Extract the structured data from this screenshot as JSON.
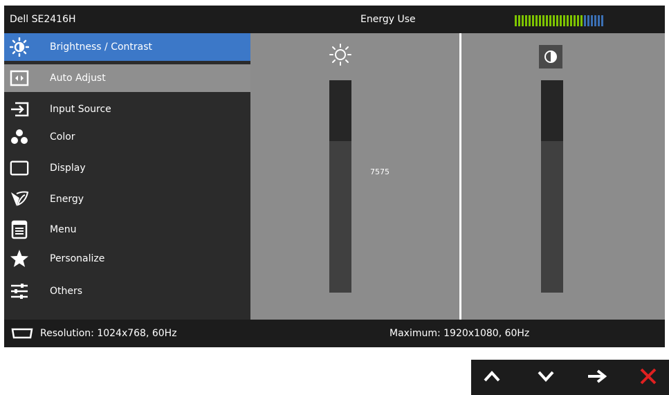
{
  "header": {
    "model": "Dell SE2416H",
    "energy_label": "Energy Use"
  },
  "energy_meter": {
    "level": 0.78,
    "segments": 26,
    "active_color": "#7ec400",
    "inactive_color": "#3b6fb3"
  },
  "menu": {
    "items": [
      {
        "label": "Brightness / Contrast",
        "icon": "brightness-icon",
        "state": "selected"
      },
      {
        "label": "Auto Adjust",
        "icon": "auto-adjust-icon",
        "state": "highlight"
      },
      {
        "label": "Input Source",
        "icon": "input-source-icon",
        "state": ""
      },
      {
        "label": "Color",
        "icon": "color-icon",
        "state": ""
      },
      {
        "label": "Display",
        "icon": "display-icon",
        "state": ""
      },
      {
        "label": "Energy",
        "icon": "energy-icon",
        "state": ""
      },
      {
        "label": "Menu",
        "icon": "menu-icon",
        "state": ""
      },
      {
        "label": "Personalize",
        "icon": "personalize-icon",
        "state": ""
      },
      {
        "label": "Others",
        "icon": "others-icon",
        "state": ""
      }
    ]
  },
  "brightness": {
    "icon": "sun-icon",
    "value_text": "7575",
    "level": 0.75
  },
  "contrast": {
    "icon": "contrast-icon",
    "level": 0.75
  },
  "footer": {
    "resolution": "Resolution: 1024x768, 60Hz",
    "maximum": "Maximum: 1920x1080, 60Hz"
  },
  "buttons": [
    {
      "icon": "up-arrow-icon"
    },
    {
      "icon": "down-arrow-icon"
    },
    {
      "icon": "right-arrow-icon"
    },
    {
      "icon": "close-icon",
      "color": "#e02020"
    }
  ]
}
